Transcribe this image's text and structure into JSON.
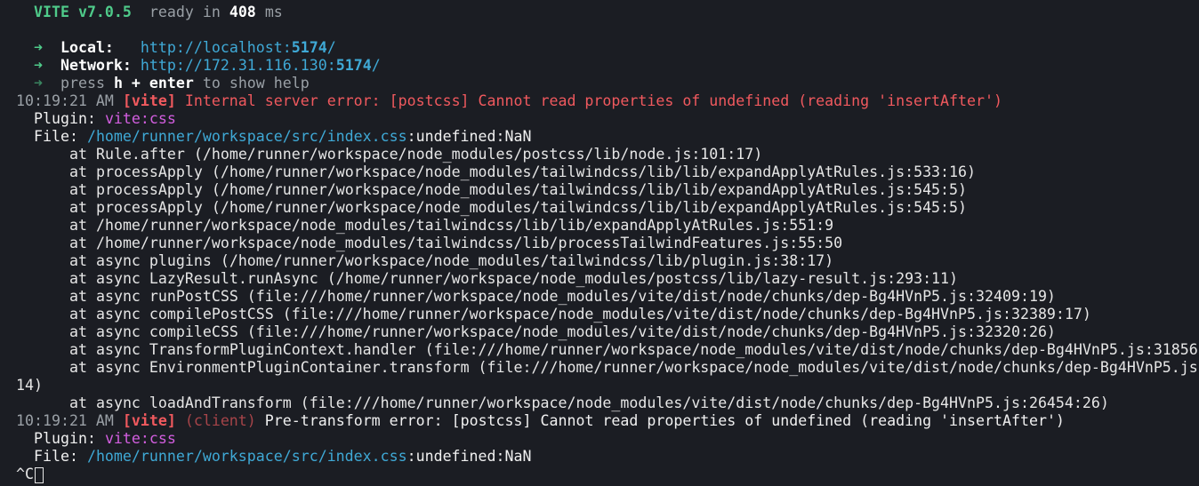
{
  "header": {
    "vite_label": "VITE v7.0.5",
    "ready_text": "ready in",
    "ready_ms": "408",
    "ms_unit": "ms"
  },
  "urls": {
    "arrow": "➜",
    "local_label": "Local:",
    "local_prefix": "http://localhost:",
    "local_port": "5174",
    "local_suffix": "/",
    "network_label": "Network:",
    "network_prefix": "http://172.31.116.130:",
    "network_port": "5174",
    "network_suffix": "/",
    "help_press": "press",
    "help_key": "h + enter",
    "help_rest": "to show help"
  },
  "error1": {
    "time": "10:19:21 AM",
    "tag": "[vite]",
    "message": "Internal server error: [postcss] Cannot read properties of undefined (reading 'insertAfter')",
    "plugin_label": "Plugin:",
    "plugin_value": "vite:css",
    "file_label": "File:",
    "file_path": "/home/runner/workspace/src/index.css",
    "file_suffix": ":undefined:NaN"
  },
  "stack": [
    "at Rule.after (/home/runner/workspace/node_modules/postcss/lib/node.js:101:17)",
    "at processApply (/home/runner/workspace/node_modules/tailwindcss/lib/lib/expandApplyAtRules.js:533:16)",
    "at processApply (/home/runner/workspace/node_modules/tailwindcss/lib/lib/expandApplyAtRules.js:545:5)",
    "at processApply (/home/runner/workspace/node_modules/tailwindcss/lib/lib/expandApplyAtRules.js:545:5)",
    "at /home/runner/workspace/node_modules/tailwindcss/lib/lib/expandApplyAtRules.js:551:9",
    "at /home/runner/workspace/node_modules/tailwindcss/lib/processTailwindFeatures.js:55:50",
    "at async plugins (/home/runner/workspace/node_modules/tailwindcss/lib/plugin.js:38:17)",
    "at async LazyResult.runAsync (/home/runner/workspace/node_modules/postcss/lib/lazy-result.js:293:11)",
    "at async runPostCSS (file:///home/runner/workspace/node_modules/vite/dist/node/chunks/dep-Bg4HVnP5.js:32409:19)",
    "at async compilePostCSS (file:///home/runner/workspace/node_modules/vite/dist/node/chunks/dep-Bg4HVnP5.js:32389:17)",
    "at async compileCSS (file:///home/runner/workspace/node_modules/vite/dist/node/chunks/dep-Bg4HVnP5.js:32320:26)",
    "at async TransformPluginContext.handler (file:///home/runner/workspace/node_modules/vite/dist/node/chunks/dep-Bg4HVnP5.js:31856",
    "at async EnvironmentPluginContainer.transform (file:///home/runner/workspace/node_modules/vite/dist/node/chunks/dep-Bg4HVnP5.js"
  ],
  "wrap_continuation": "14)",
  "stack_last": "at async loadAndTransform (file:///home/runner/workspace/node_modules/vite/dist/node/chunks/dep-Bg4HVnP5.js:26454:26)",
  "error2": {
    "time": "10:19:21 AM",
    "tag": "[vite]",
    "client": "(client)",
    "message": "Pre-transform error: [postcss] Cannot read properties of undefined (reading 'insertAfter')",
    "plugin_label": "Plugin:",
    "plugin_value": "vite:css",
    "file_label": "File:",
    "file_path": "/home/runner/workspace/src/index.css",
    "file_suffix": ":undefined:NaN"
  },
  "prompt": {
    "ctrl_c": "^C"
  }
}
